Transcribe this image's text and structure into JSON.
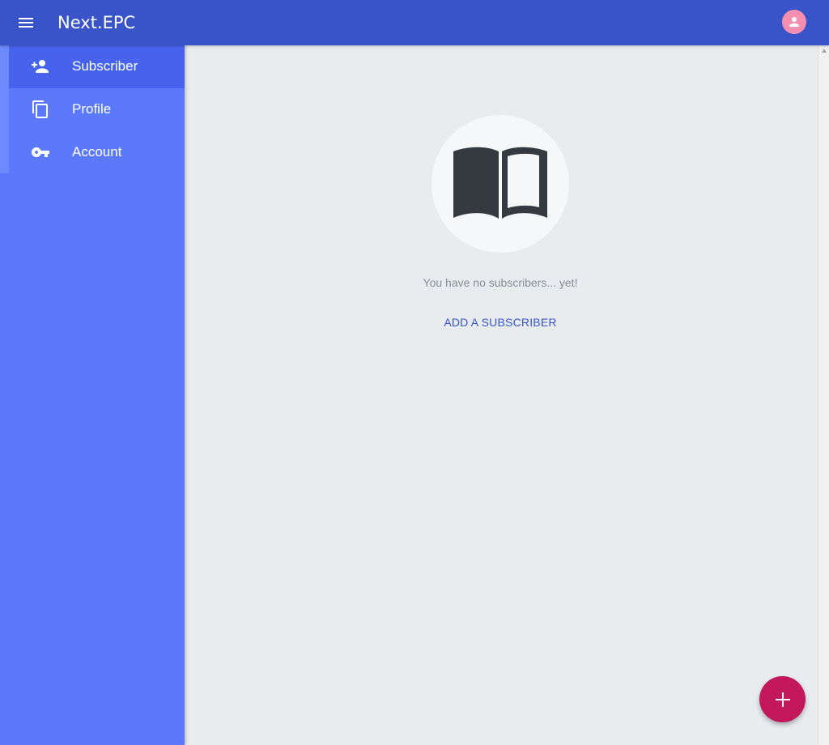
{
  "header": {
    "title": "Next.EPC",
    "menu_icon": "menu-icon",
    "account_icon": "account-circle-icon",
    "background": "#3953c8",
    "avatar_color": "#f48fb1"
  },
  "sidebar": {
    "background": "#5b79fa",
    "active_background": "#4763ee",
    "items": [
      {
        "label": "Subscriber",
        "icon": "person-add-icon",
        "active": true
      },
      {
        "label": "Profile",
        "icon": "copy-icon",
        "active": false
      },
      {
        "label": "Account",
        "icon": "key-icon",
        "active": false
      }
    ]
  },
  "main": {
    "empty_icon": "open-book-icon",
    "empty_message": "You have no subscribers... yet!",
    "add_link": "ADD A SUBSCRIBER"
  },
  "fab": {
    "icon": "add-icon",
    "color": "#c2185b"
  }
}
